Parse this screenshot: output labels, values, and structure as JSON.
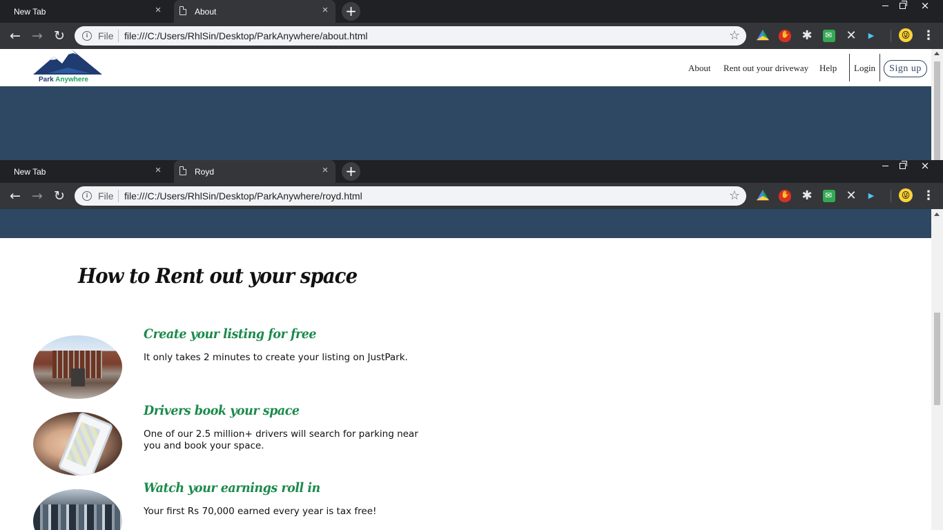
{
  "windows": [
    {
      "tabs": [
        {
          "label": "New Tab"
        },
        {
          "label": "About"
        }
      ],
      "omnibox": {
        "scheme": "File",
        "url": "file:///C:/Users/RhlSin/Desktop/ParkAnywhere/about.html"
      }
    },
    {
      "tabs": [
        {
          "label": "New Tab"
        },
        {
          "label": "Royd"
        }
      ],
      "omnibox": {
        "scheme": "File",
        "url": "file:///C:/Users/RhlSin/Desktop/ParkAnywhere/royd.html"
      }
    }
  ],
  "chrome": {
    "close_glyph": "×",
    "newtab_glyph": "+",
    "window_close_glyph": "×",
    "back_glyph": "←",
    "forward_glyph": "→",
    "reload_glyph": "↻",
    "star_glyph": "☆",
    "menu_glyph": "⋮",
    "info_glyph": "i",
    "puzzle_glyph": "✱",
    "x_ext_glyph": "✕",
    "play_glyph": "▶",
    "avatar_glyph": "😜",
    "icons": [
      "back-icon",
      "forward-icon",
      "reload-icon",
      "info-icon",
      "star-icon",
      "menu-icon"
    ]
  },
  "site": {
    "logo": {
      "word1": "Park",
      "word2": "Anywhere"
    },
    "nav": {
      "about": "About",
      "rent": "Rent out your driveway",
      "help": "Help",
      "login": "Login",
      "signup": "Sign up"
    },
    "colors": {
      "band": "#2e4864",
      "accent_green": "#1b8a4b"
    }
  },
  "royd": {
    "title": "How to Rent out your space",
    "steps": [
      {
        "title": "Create your listing for free",
        "desc": "It only takes 2 minutes to create your listing on JustPark."
      },
      {
        "title": "Drivers book your space",
        "desc": "One of our 2.5 million+ drivers will search for parking near you and book your space."
      },
      {
        "title": "Watch your earnings roll in",
        "desc": "Your first Rs 70,000 earned every year is tax free!"
      }
    ]
  }
}
